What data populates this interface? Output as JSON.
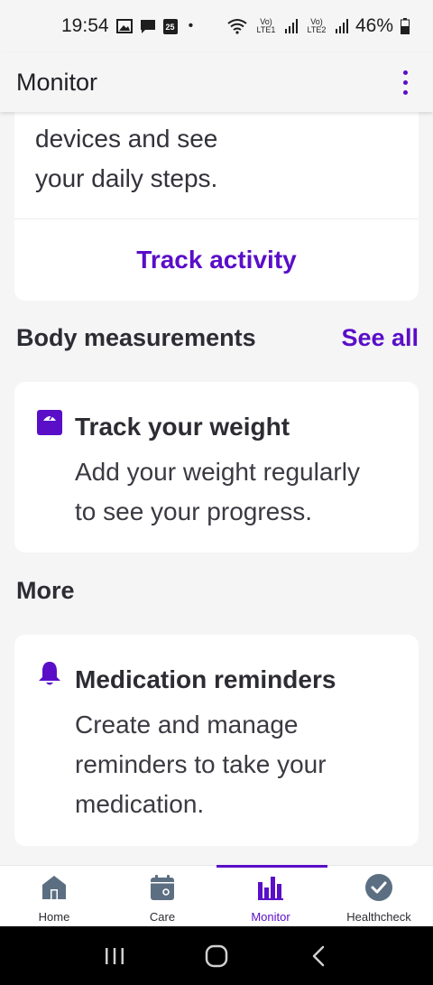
{
  "status_bar": {
    "time": "19:54",
    "notification_icons": [
      "gallery-icon",
      "message-icon",
      "calendar-icon"
    ],
    "calendar_day": "25",
    "dot": "•",
    "sim1_label": "Vo) LTE1",
    "sim2_label": "Vo) LTE2",
    "battery": "46%"
  },
  "app_bar": {
    "title": "Monitor"
  },
  "activity_card": {
    "text_line1": "devices and see",
    "text_line2": "your daily steps.",
    "action_label": "Track activity"
  },
  "body_measurements": {
    "title": "Body measurements",
    "see_all": "See all",
    "card": {
      "icon": "scale-icon",
      "title": "Track your weight",
      "desc_line1": "Add your weight regularly",
      "desc_line2": "to see your progress."
    }
  },
  "more": {
    "title": "More",
    "card": {
      "icon": "bell-icon",
      "title": "Medication reminders",
      "desc_line1": "Create and manage",
      "desc_line2": "reminders to take your",
      "desc_line3": "medication."
    }
  },
  "bottom_nav": {
    "items": [
      {
        "label": "Home",
        "icon": "home-icon"
      },
      {
        "label": "Care",
        "icon": "calendar-icon"
      },
      {
        "label": "Monitor",
        "icon": "bar-chart-icon"
      },
      {
        "label": "Healthcheck",
        "icon": "check-circle-icon"
      }
    ],
    "active": "Monitor"
  },
  "colors": {
    "accent": "#5a0ec8",
    "background": "#f5f5f6",
    "card": "#ffffff",
    "text": "#2c2c33",
    "nav_icon": "#5c6f82"
  }
}
